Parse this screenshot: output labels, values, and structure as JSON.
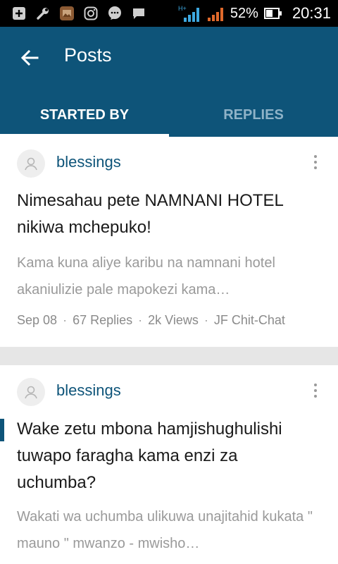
{
  "status_bar": {
    "icons": [
      "add-box-icon",
      "wrench-icon",
      "gallery-icon",
      "instagram-icon",
      "chat-bubble-icon",
      "message-icon"
    ],
    "network_label": "H+",
    "battery_percent": "52%",
    "time": "20:31"
  },
  "app_bar": {
    "title": "Posts",
    "tabs": [
      {
        "label": "STARTED BY",
        "active": true
      },
      {
        "label": "REPLIES",
        "active": false
      }
    ]
  },
  "posts": [
    {
      "author": "blessings",
      "title": "Nimesahau pete NAMNANI HOTEL nikiwa mchepuko!",
      "excerpt": "Kama kuna aliye karibu na namnani hotel akaniulizie pale mapokezi kama…",
      "date": "Sep 08",
      "replies": "67 Replies",
      "views": "2k Views",
      "forum": "JF Chit-Chat"
    },
    {
      "author": "blessings",
      "title": "Wake zetu mbona hamjishughulishi tuwapo faragha kama enzi za uchumba?",
      "excerpt": "Wakati wa uchumba ulikuwa unajitahid kukata \" mauno \" mwanzo - mwisho…"
    }
  ],
  "colors": {
    "app_bar": "#0e5479",
    "accent": "#0e5479",
    "divider": "#e6e6e6"
  }
}
